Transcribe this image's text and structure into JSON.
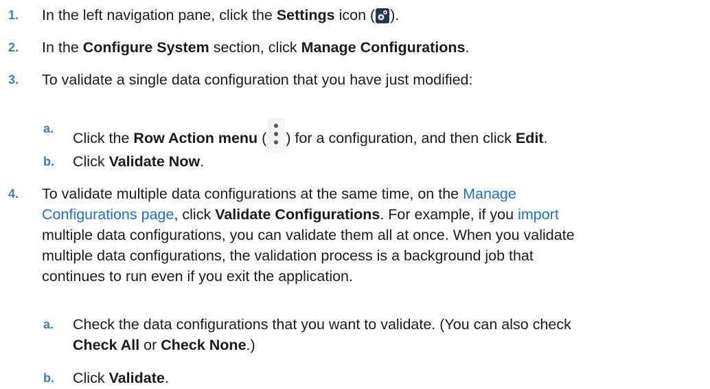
{
  "steps": [
    {
      "num": "1.",
      "t1": "In the left navigation pane, click the ",
      "b1": "Settings",
      "t2": " icon (",
      "icon": "gear-icon",
      "t3": ")."
    },
    {
      "num": "2.",
      "t1": "In the ",
      "b1": "Configure System",
      "t2": " section, click ",
      "b2": "Manage Configurations",
      "t3": "."
    },
    {
      "num": "3.",
      "t1": "To validate a single data configuration that you have just modified:",
      "substeps": [
        {
          "num": "a.",
          "t1": "Click the ",
          "b1": "Row Action menu",
          "t2": " (",
          "icon": "vertical-ellipsis-icon",
          "t3": ") for a configuration, and then click ",
          "b2": "Edit",
          "t4": "."
        },
        {
          "num": "b.",
          "t1": "Click ",
          "b1": "Validate Now",
          "t2": "."
        }
      ]
    },
    {
      "num": "4.",
      "line1_t1": "To validate multiple data configurations at the same time, on the ",
      "link1_part1": "Manage",
      "link1_part2": "Configurations page",
      "line2_t1": ", click ",
      "b1": "Validate Configurations",
      "line2_t2": ". For example, if you ",
      "link2": "import",
      "line3": "multiple data configurations, you can validate them all at once. When you validate",
      "line4": "multiple data configurations, the validation process is a background job that",
      "line5": "continues to run even if you exit the application.",
      "substeps": [
        {
          "num": "a.",
          "line1": "Check the data configurations that you want to validate. (You can also check",
          "b1": "Check All",
          "t1": " or ",
          "b2": "Check None",
          "t2": ".)"
        },
        {
          "num": "b.",
          "t1": "Click ",
          "b1": "Validate",
          "t2": "."
        }
      ]
    }
  ]
}
